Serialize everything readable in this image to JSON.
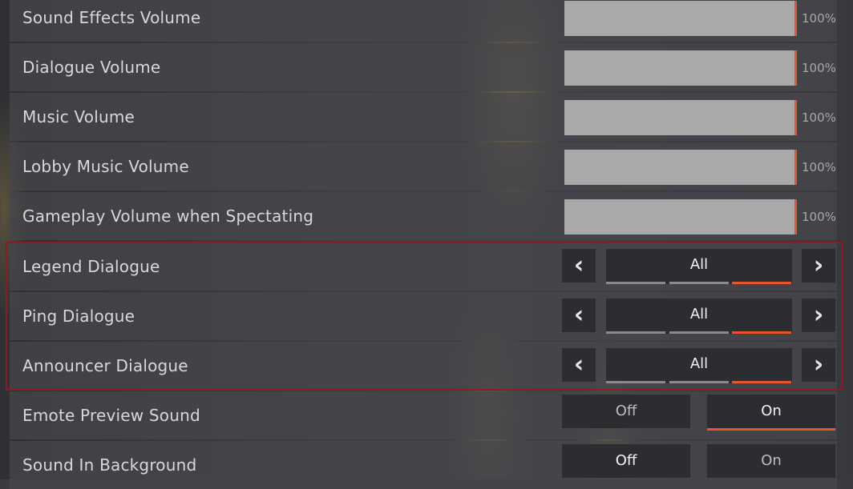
{
  "sliders": [
    {
      "label": "Sound Effects Volume",
      "value": "100%",
      "level": 1.0
    },
    {
      "label": "Dialogue Volume",
      "value": "100%",
      "level": 1.0
    },
    {
      "label": "Music Volume",
      "value": "100%",
      "level": 1.0
    },
    {
      "label": "Lobby Music Volume",
      "value": "100%",
      "level": 1.0
    },
    {
      "label": "Gameplay Volume when Spectating",
      "value": "100%",
      "level": 1.0
    }
  ],
  "selectors": [
    {
      "label": "Legend Dialogue",
      "value": "All",
      "option_count": 3,
      "selected_index": 2
    },
    {
      "label": "Ping Dialogue",
      "value": "All",
      "option_count": 3,
      "selected_index": 2
    },
    {
      "label": "Announcer Dialogue",
      "value": "All",
      "option_count": 3,
      "selected_index": 2
    }
  ],
  "toggles": [
    {
      "label": "Emote Preview Sound",
      "off_label": "Off",
      "on_label": "On",
      "selected": "On"
    },
    {
      "label": "Sound In Background",
      "off_label": "Off",
      "on_label": "On",
      "selected": "Off"
    }
  ],
  "icons": {
    "left": "chevron-left-icon",
    "right": "chevron-right-icon"
  },
  "colors": {
    "accent": "#e4572e",
    "highlight_border": "#8e1a25"
  }
}
